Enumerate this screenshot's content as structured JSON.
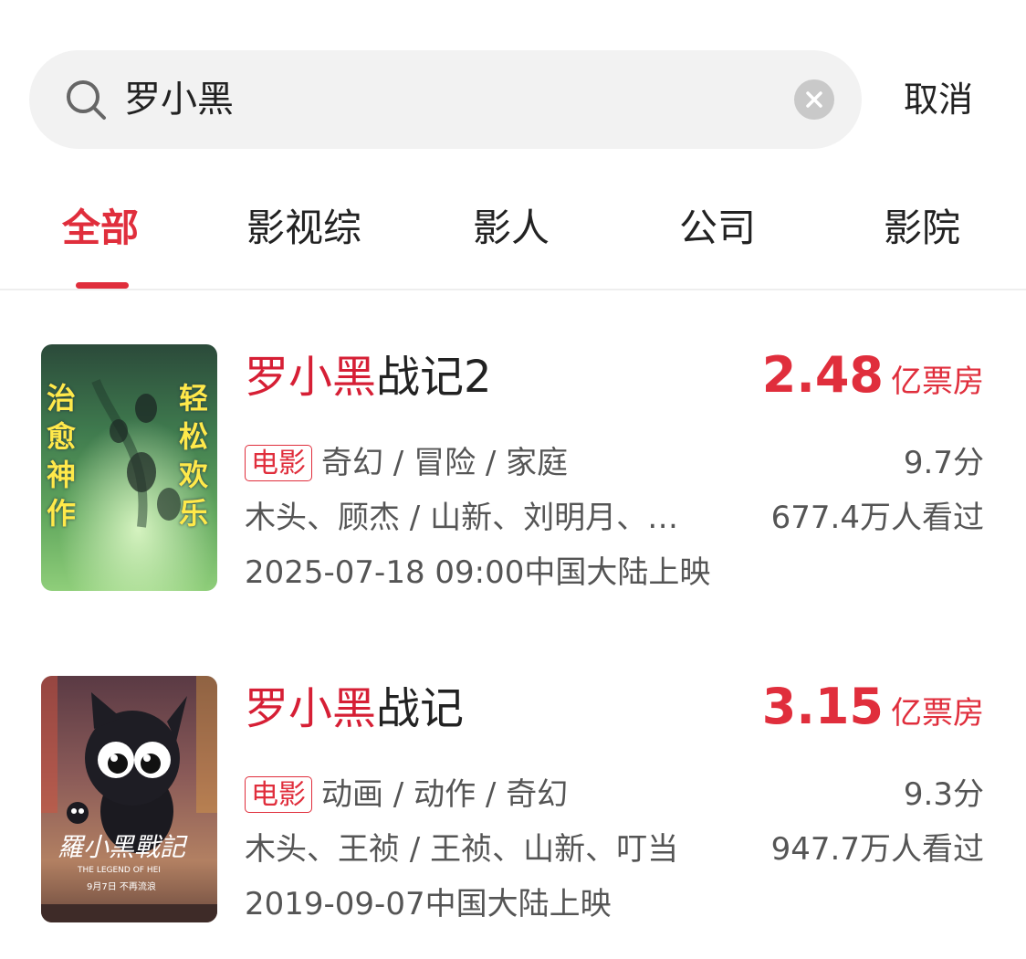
{
  "search": {
    "query": "罗小黑"
  },
  "header": {
    "cancel_label": "取消"
  },
  "tabs": [
    {
      "label": "全部",
      "active": true
    },
    {
      "label": "影视综"
    },
    {
      "label": "影人"
    },
    {
      "label": "公司"
    },
    {
      "label": "影院"
    }
  ],
  "results": [
    {
      "title_highlight": "罗小黑",
      "title_rest": "战记2",
      "box_office_value": "2.48",
      "box_office_unit": "亿票房",
      "tag": "电影",
      "genres": "奇幻 / 冒险 / 家庭",
      "score": "9.7分",
      "credits": "木头、顾杰 / 山新、刘明月、…",
      "viewers": "677.4万人看过",
      "release": "2025-07-18 09:00中国大陆上映",
      "poster_text": {
        "left": "治愈神作",
        "right": "轻松欢乐"
      }
    },
    {
      "title_highlight": "罗小黑",
      "title_rest": "战记",
      "box_office_value": "3.15",
      "box_office_unit": "亿票房",
      "tag": "电影",
      "genres": "动画 / 动作 / 奇幻",
      "score": "9.3分",
      "credits": "木头、王祯 / 王祯、山新、叮当",
      "viewers": "947.7万人看过",
      "release": "2019-09-07中国大陆上映",
      "poster_text": {
        "logo": "羅小黑戰記",
        "subtitle": "THE LEGEND OF HEI",
        "date": "9月7日  不再流浪"
      }
    }
  ],
  "colors": {
    "accent": "#e02e3c",
    "title_highlight": "#d61f35"
  }
}
